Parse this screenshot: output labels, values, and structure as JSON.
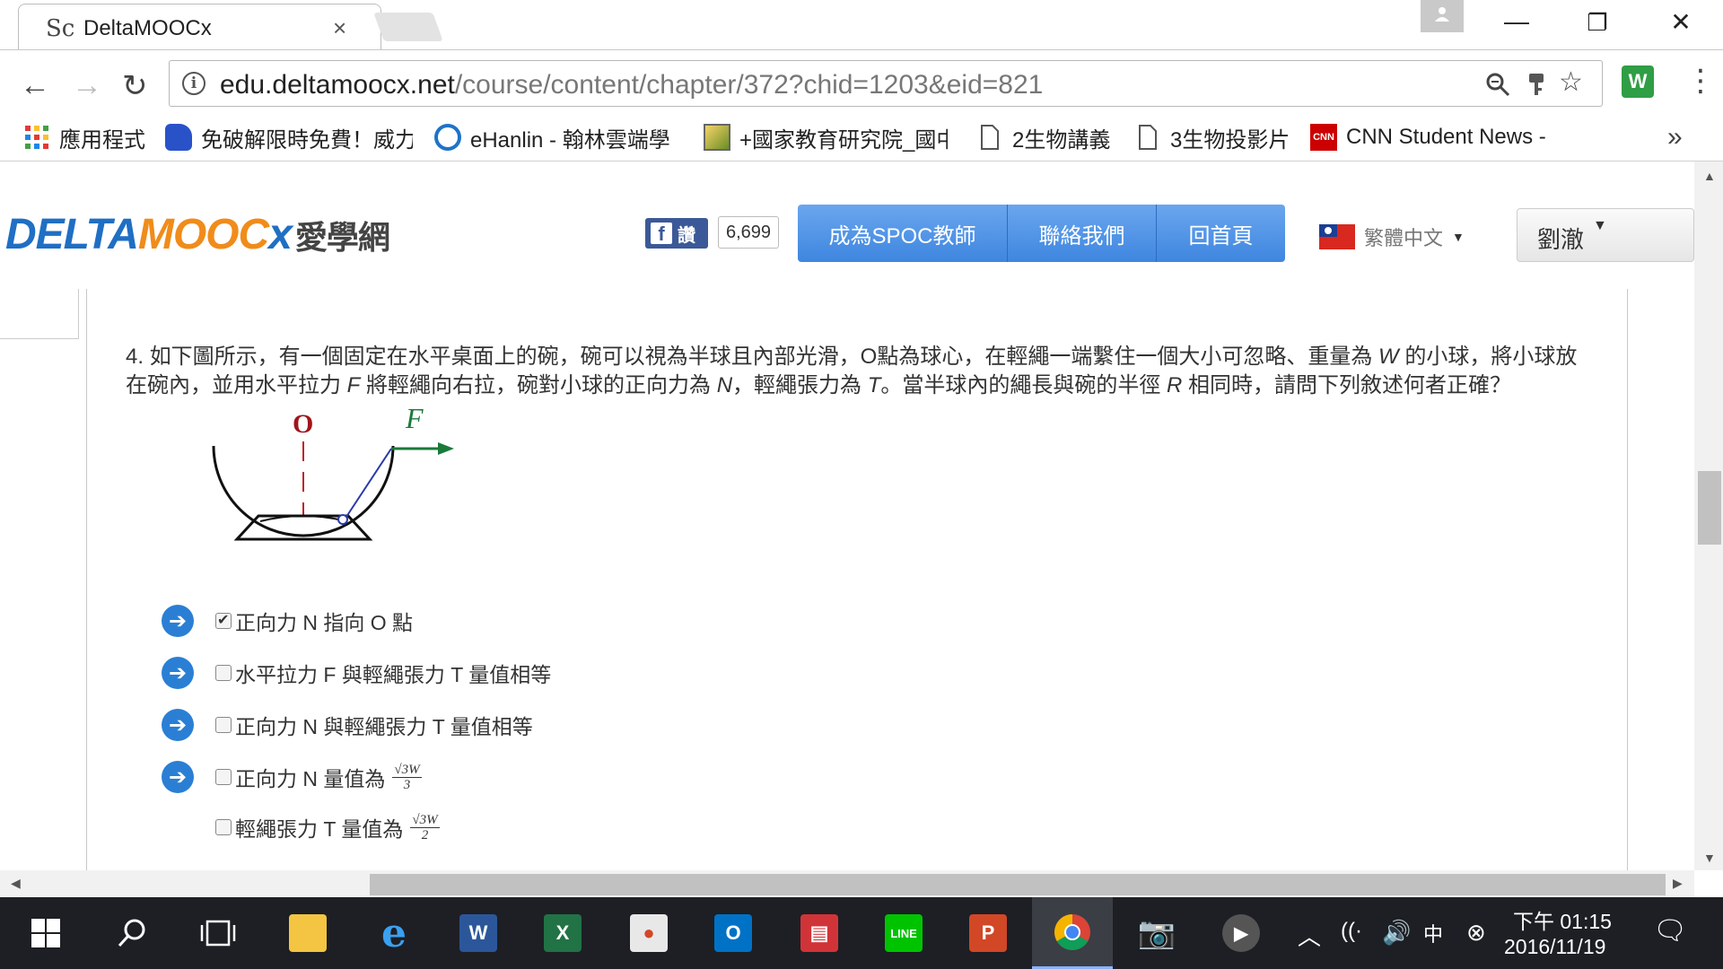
{
  "tab": {
    "title": "DeltaMOOCx",
    "favicon": "Sc"
  },
  "omnibox": {
    "domain": "edu.deltamoocx.net",
    "path": "/course/content/chapter/372?chid=1203&eid=821"
  },
  "bookmarks": [
    {
      "label": "應用程式",
      "icon": "apps-grid-icon"
    },
    {
      "label": "免破解限時免費！威力",
      "icon": "blue-app-icon"
    },
    {
      "label": "eHanlin - 翰林雲端學",
      "icon": "ehanlin-icon"
    },
    {
      "label": "+國家教育研究院_國中",
      "icon": "image-icon"
    },
    {
      "label": "2生物講義",
      "icon": "page-icon"
    },
    {
      "label": "3生物投影片",
      "icon": "page-icon"
    },
    {
      "label": "CNN Student News -",
      "icon": "cnn-icon"
    }
  ],
  "header": {
    "logo_latin_d": "DELTA",
    "logo_latin_m": "MOOC",
    "logo_latin_x": "x",
    "logo_zh": "愛學網",
    "fb_like": "讚",
    "fb_count": "6,699",
    "nav": [
      "成為SPOC教師",
      "聯絡我們",
      "回首頁"
    ],
    "language": "繁體中文",
    "user": "劉澈"
  },
  "question": {
    "number": "4.",
    "text_parts": [
      "如下圖所示，有一個固定在水平桌面上的碗，碗可以視為半球且內部光滑，O點為球心，在輕繩一端繫住一個大小可忽略、重量為 ",
      "W",
      " 的小球，將小球放在碗內，並用水平拉力 ",
      "F",
      " 將輕繩向右拉，碗對小球的正向力為 ",
      "N",
      "，輕繩張力為 ",
      "T",
      "。當半球內的繩長與碗的半徑 ",
      "R",
      " 相同時，請問下列敘述何者正確？"
    ],
    "diagram": {
      "center_label": "O",
      "force_label": "F"
    }
  },
  "options": [
    {
      "text": "正向力 N 指向 O 點",
      "checked": true,
      "arrow": true,
      "frac": null
    },
    {
      "text": "水平拉力 F 與輕繩張力 T 量值相等",
      "checked": false,
      "arrow": true,
      "frac": null
    },
    {
      "text": "正向力 N 與輕繩張力 T 量值相等",
      "checked": false,
      "arrow": true,
      "frac": null
    },
    {
      "text": "正向力 N 量值為",
      "checked": false,
      "arrow": true,
      "frac": {
        "num": "√3W",
        "den": "3"
      }
    },
    {
      "text": "輕繩張力 T 量值為",
      "checked": false,
      "arrow": false,
      "frac": {
        "num": "√3W",
        "den": "2"
      }
    }
  ],
  "taskbar": {
    "apps": [
      "start",
      "search",
      "task-view",
      "file-explorer",
      "internet-explorer",
      "word",
      "excel",
      "photos",
      "outlook",
      "news",
      "line",
      "powerpoint",
      "chrome",
      "camera",
      "media-player"
    ],
    "clock_time": "下午 01:15",
    "clock_date": "2016/11/19"
  },
  "colors": {
    "accent": "#3f86e0",
    "option_arrow": "#2a7fd4",
    "logo_blue": "#1f6fc4",
    "logo_orange": "#f08c1a"
  }
}
